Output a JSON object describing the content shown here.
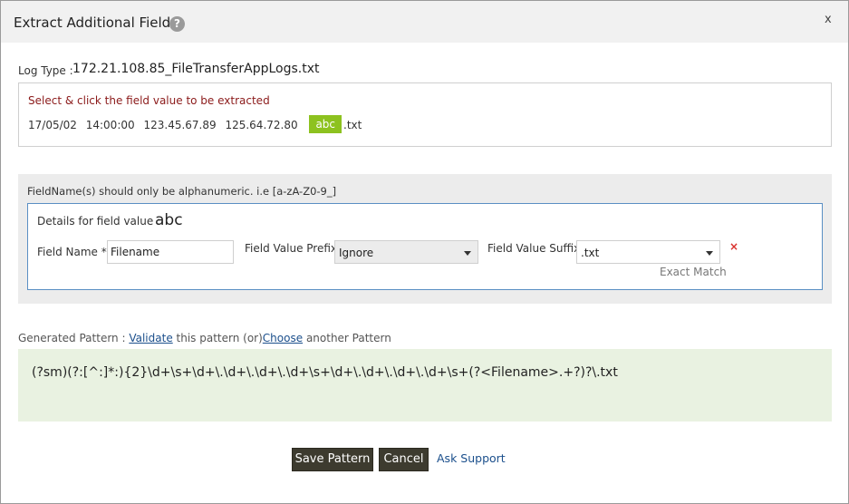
{
  "dialog": {
    "title": "Extract Additional Fields",
    "help_icon": "question-mark-icon",
    "help_glyph": "?",
    "close_glyph": "x"
  },
  "log_type": {
    "label": "Log Type :",
    "value": "172.21.108.85_FileTransferAppLogs.txt"
  },
  "sample": {
    "hint": "Select & click the field value to be extracted",
    "segments": [
      "17/05/02",
      "14:00:00",
      "123.45.67.89",
      "125.64.72.80"
    ],
    "highlighted": "abc",
    "suffix": ".txt",
    "highlight_color": "#8dc21f"
  },
  "fields": {
    "note": "FieldName(s) should only be alphanumeric. i.e [a-zA-Z0-9_]",
    "details_label": "Details for field value :",
    "details_value": "abc",
    "field_name_label": "Field Name *",
    "field_name_value": "Filename",
    "prefix_label": "Field Value Prefix",
    "prefix_value": "Ignore",
    "suffix_label": "Field Value Suffix",
    "suffix_value": ".txt",
    "remove_glyph": "×",
    "match_text": "Exact Match"
  },
  "pattern": {
    "label": "Generated Pattern :",
    "validate_link": "Validate",
    "middle_text": "this pattern (or)",
    "choose_link": "Choose",
    "end_text": "another Pattern",
    "value": "(?sm)(?:[^:]*:){2}\\d+\\s+\\d+\\.\\d+\\.\\d+\\.\\d+\\s+\\d+\\.\\d+\\.\\d+\\.\\d+\\s+(?<Filename>.+?)?\\.txt"
  },
  "actions": {
    "save_label": "Save Pattern",
    "cancel_label": "Cancel",
    "support_label": "Ask Support"
  }
}
